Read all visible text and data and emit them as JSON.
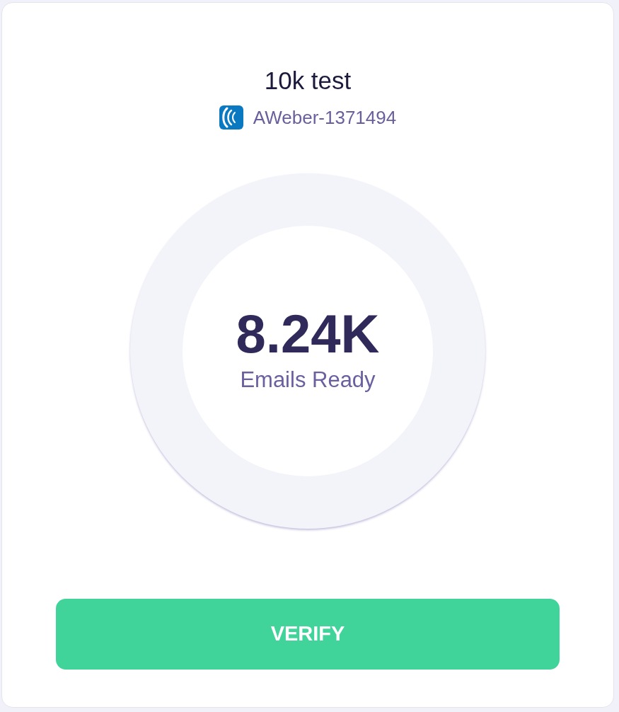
{
  "card": {
    "title": "10k test",
    "source": {
      "label": "AWeber-1371494"
    }
  },
  "stat": {
    "value": "8.24K",
    "caption": "Emails Ready"
  },
  "button": {
    "label": "VERIFY"
  }
}
